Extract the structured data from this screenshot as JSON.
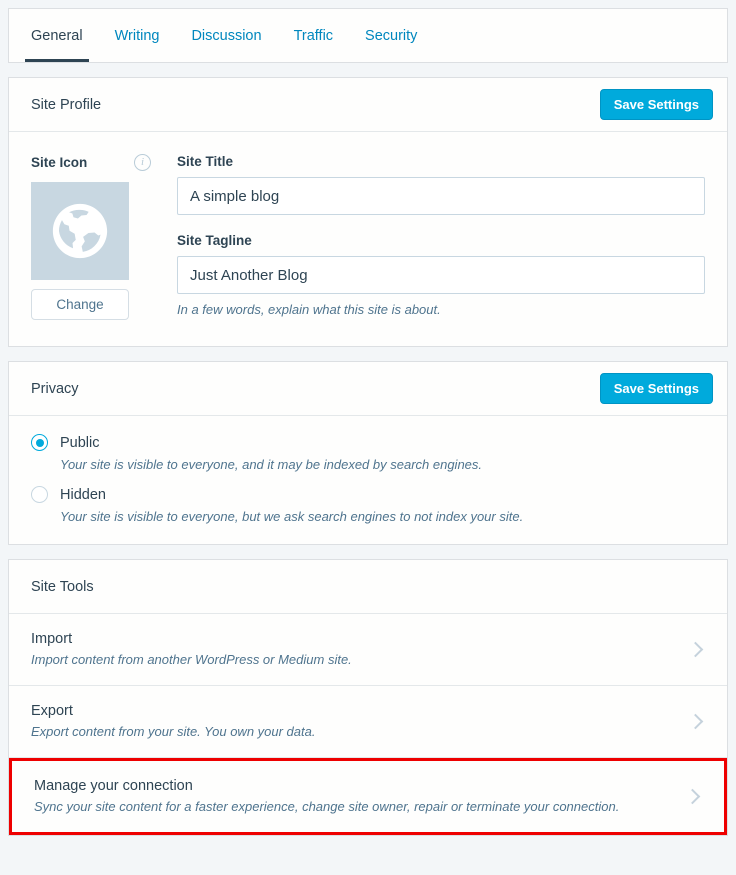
{
  "tabs": [
    {
      "label": "General",
      "active": true
    },
    {
      "label": "Writing",
      "active": false
    },
    {
      "label": "Discussion",
      "active": false
    },
    {
      "label": "Traffic",
      "active": false
    },
    {
      "label": "Security",
      "active": false
    }
  ],
  "site_profile": {
    "title": "Site Profile",
    "save_label": "Save Settings",
    "site_icon": {
      "label": "Site Icon",
      "info_icon": "info-icon",
      "glyph": "globe-icon",
      "change_label": "Change"
    },
    "site_title": {
      "label": "Site Title",
      "value": "A simple blog"
    },
    "site_tagline": {
      "label": "Site Tagline",
      "value": "Just Another Blog",
      "hint": "In a few words, explain what this site is about."
    }
  },
  "privacy": {
    "title": "Privacy",
    "save_label": "Save Settings",
    "options": [
      {
        "label": "Public",
        "description": "Your site is visible to everyone, and it may be indexed by search engines.",
        "selected": true
      },
      {
        "label": "Hidden",
        "description": "Your site is visible to everyone, but we ask search engines to not index your site.",
        "selected": false
      }
    ]
  },
  "site_tools": {
    "title": "Site Tools",
    "rows": [
      {
        "title": "Import",
        "description": "Import content from another WordPress or Medium site.",
        "highlighted": false
      },
      {
        "title": "Export",
        "description": "Export content from your site. You own your data.",
        "highlighted": false
      },
      {
        "title": "Manage your connection",
        "description": "Sync your site content for a faster experience, change site owner, repair or terminate your connection.",
        "highlighted": true
      }
    ]
  },
  "colors": {
    "accent": "#00aadc",
    "link": "#0087be",
    "text": "#2e4453",
    "muted": "#4f748e",
    "page_bg": "#f3f6f8",
    "icon_bg": "#c8d7e1",
    "highlight": "#ee0000"
  }
}
